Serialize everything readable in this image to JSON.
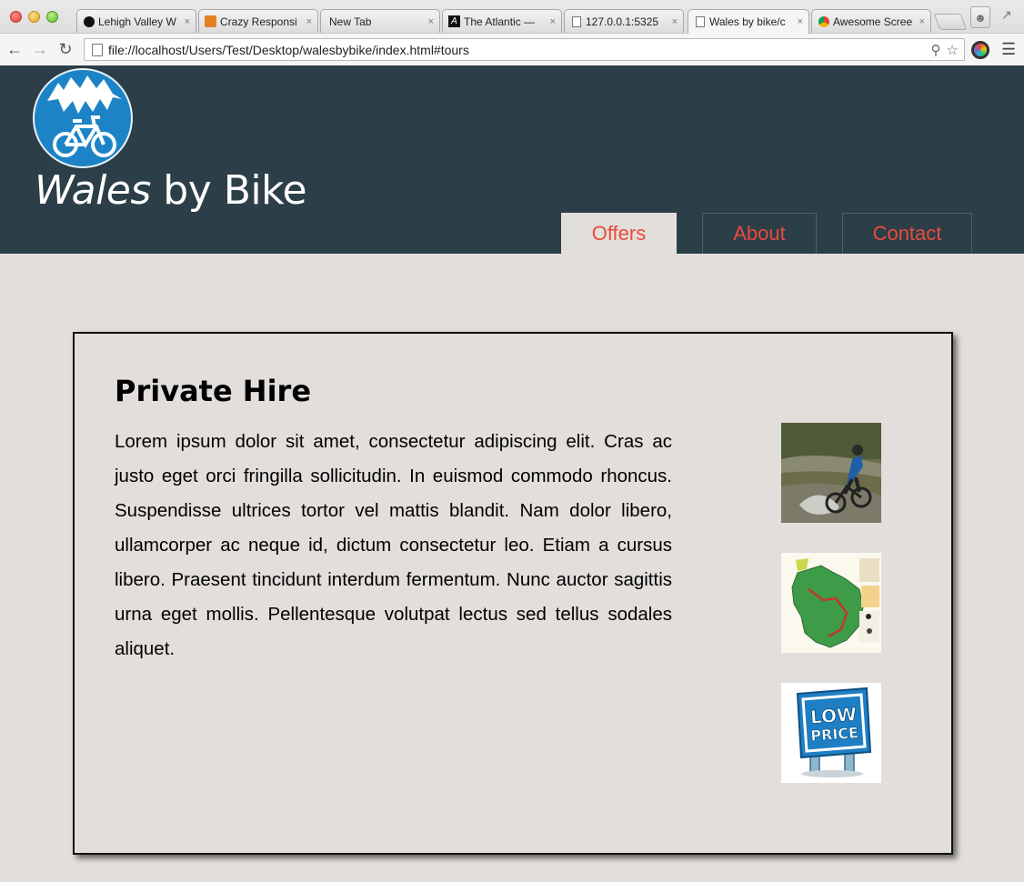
{
  "browser": {
    "tabs": [
      {
        "label": "Lehigh Valley W",
        "close": "×"
      },
      {
        "label": "Crazy Responsi",
        "close": "×"
      },
      {
        "label": "New Tab",
        "close": "×"
      },
      {
        "label": "The Atlantic —",
        "close": "×"
      },
      {
        "label": "127.0.0.1:5325",
        "close": "×"
      },
      {
        "label": "Wales by bike/c",
        "close": "×"
      },
      {
        "label": "Awesome Scree",
        "close": "×"
      }
    ],
    "url": "file://localhost/Users/Test/Desktop/walesbybike/index.html#tours"
  },
  "site": {
    "title_italic": "Wales",
    "title_rest": " by Bike",
    "nav": {
      "offers": "Offers",
      "about": "About",
      "contact": "Contact"
    }
  },
  "content": {
    "title": "Private Hire",
    "body": "Lorem ipsum dolor sit amet, consectetur adipiscing elit. Cras ac justo eget orci fringilla sollicitudin. In euismod commodo rhoncus. Suspendisse ultrices tortor vel mattis blandit. Nam dolor libero, ullamcorper ac neque id, dictum consectetur leo. Etiam a cursus libero. Praesent tincidunt interdum fermentum. Nunc auctor sagittis urna eget mollis. Pellentesque volutpat lectus sed tellus sodales aliquet.",
    "price_sign_line1": "LOW",
    "price_sign_line2": "PRICE"
  },
  "colors": {
    "header_bg": "#2c3e48",
    "page_bg": "#e2dedb",
    "nav_text": "#e74c3c",
    "logo_blue": "#1c84c6"
  }
}
